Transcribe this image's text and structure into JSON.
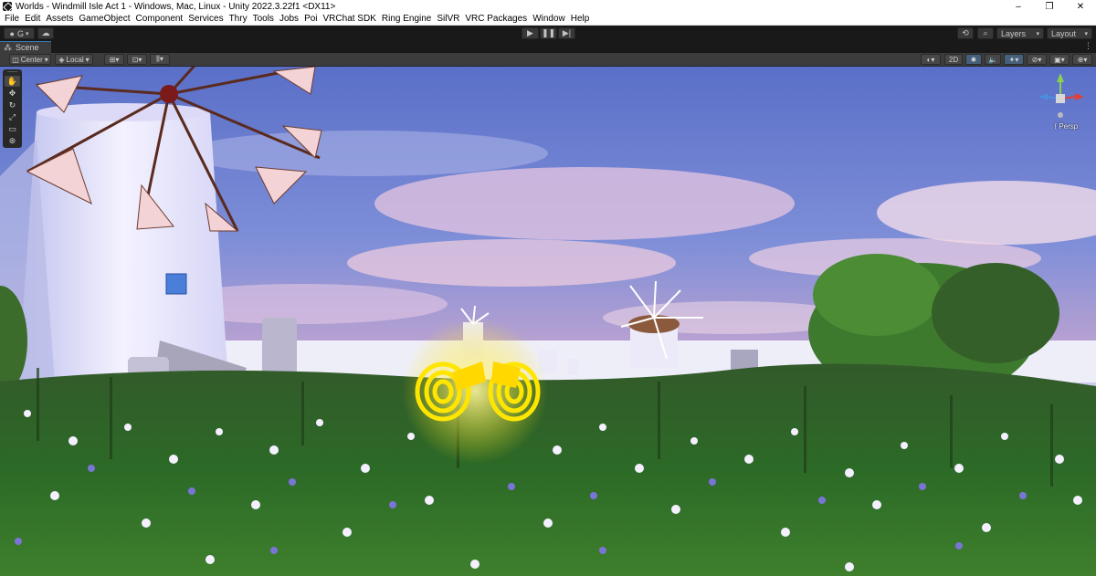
{
  "window": {
    "title": "Worlds - Windmill Isle Act 1 - Windows, Mac, Linux - Unity 2022.3.22f1 <DX11>",
    "minimize": "–",
    "maximize": "❐",
    "close": "✕"
  },
  "menu": [
    "File",
    "Edit",
    "Assets",
    "GameObject",
    "Component",
    "Services",
    "Thry",
    "Tools",
    "Jobs",
    "Poi",
    "VRChat SDK",
    "Ring Engine",
    "SilVR",
    "VRC Packages",
    "Window",
    "Help"
  ],
  "toolbar": {
    "account_label": "G",
    "play_icons": [
      "play-icon",
      "pause-icon",
      "step-icon"
    ],
    "layers_label": "Layers",
    "layout_label": "Layout"
  },
  "scene_tab": {
    "label": "Scene",
    "menu_glyph": "⋮"
  },
  "scene_toolbar": {
    "pivot_label": "Center",
    "space_label": "Local",
    "mode_2d_label": "2D"
  },
  "gizmo": {
    "projection_label": "Persp"
  },
  "colors": {
    "accent": "#3a79bb",
    "sky_top": "#5a6fc8",
    "grass": "#2f6b2a",
    "gold_object": "#ffe600"
  }
}
